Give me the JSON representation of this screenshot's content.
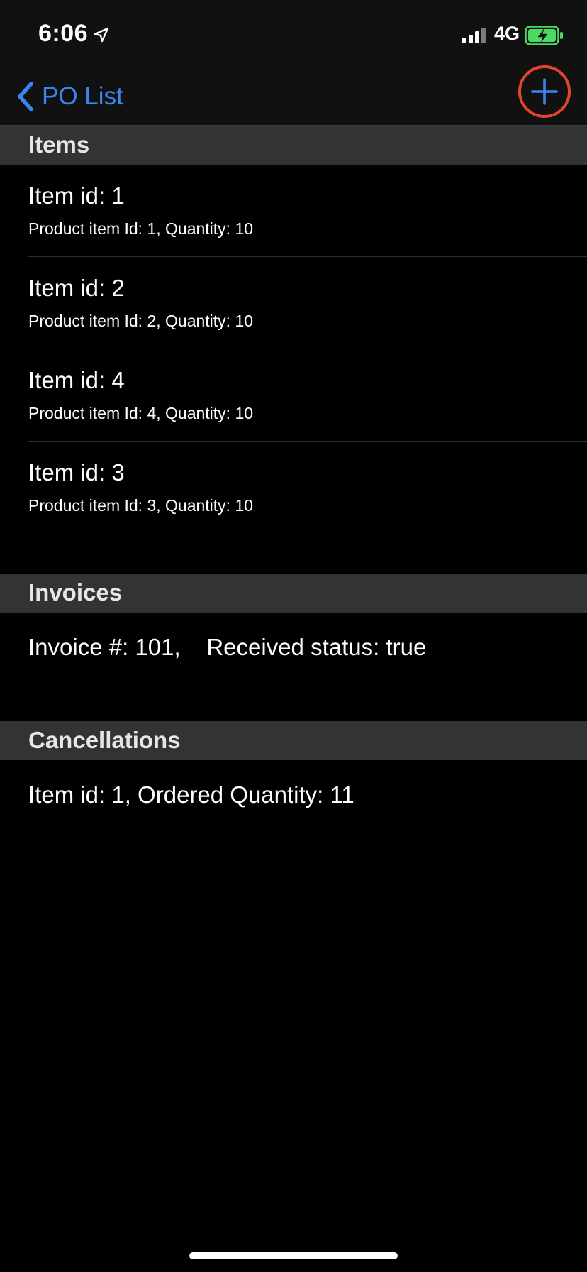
{
  "status_bar": {
    "time": "6:06",
    "network": "4G",
    "location_icon": "location-arrow-icon",
    "signal_icon": "cellular-signal-icon",
    "battery_icon": "battery-charging-icon",
    "battery_color": "#4cd964"
  },
  "nav": {
    "back_label": "PO List",
    "add_icon": "plus-icon",
    "accent_color": "#3a86f0",
    "highlight_color": "#e2452b"
  },
  "sections": {
    "items": {
      "title": "Items",
      "rows": [
        {
          "title": "Item id: 1",
          "subtitle": "Product item Id: 1, Quantity: 10"
        },
        {
          "title": "Item id: 2",
          "subtitle": "Product item Id: 2, Quantity: 10"
        },
        {
          "title": "Item id: 4",
          "subtitle": "Product item Id: 4, Quantity: 10"
        },
        {
          "title": "Item id: 3",
          "subtitle": "Product item Id: 3, Quantity: 10"
        }
      ]
    },
    "invoices": {
      "title": "Invoices",
      "rows": [
        {
          "text": "Invoice #: 101,    Received status: true"
        }
      ]
    },
    "cancellations": {
      "title": "Cancellations",
      "rows": [
        {
          "text": "Item id: 1, Ordered Quantity: 11"
        }
      ]
    }
  }
}
